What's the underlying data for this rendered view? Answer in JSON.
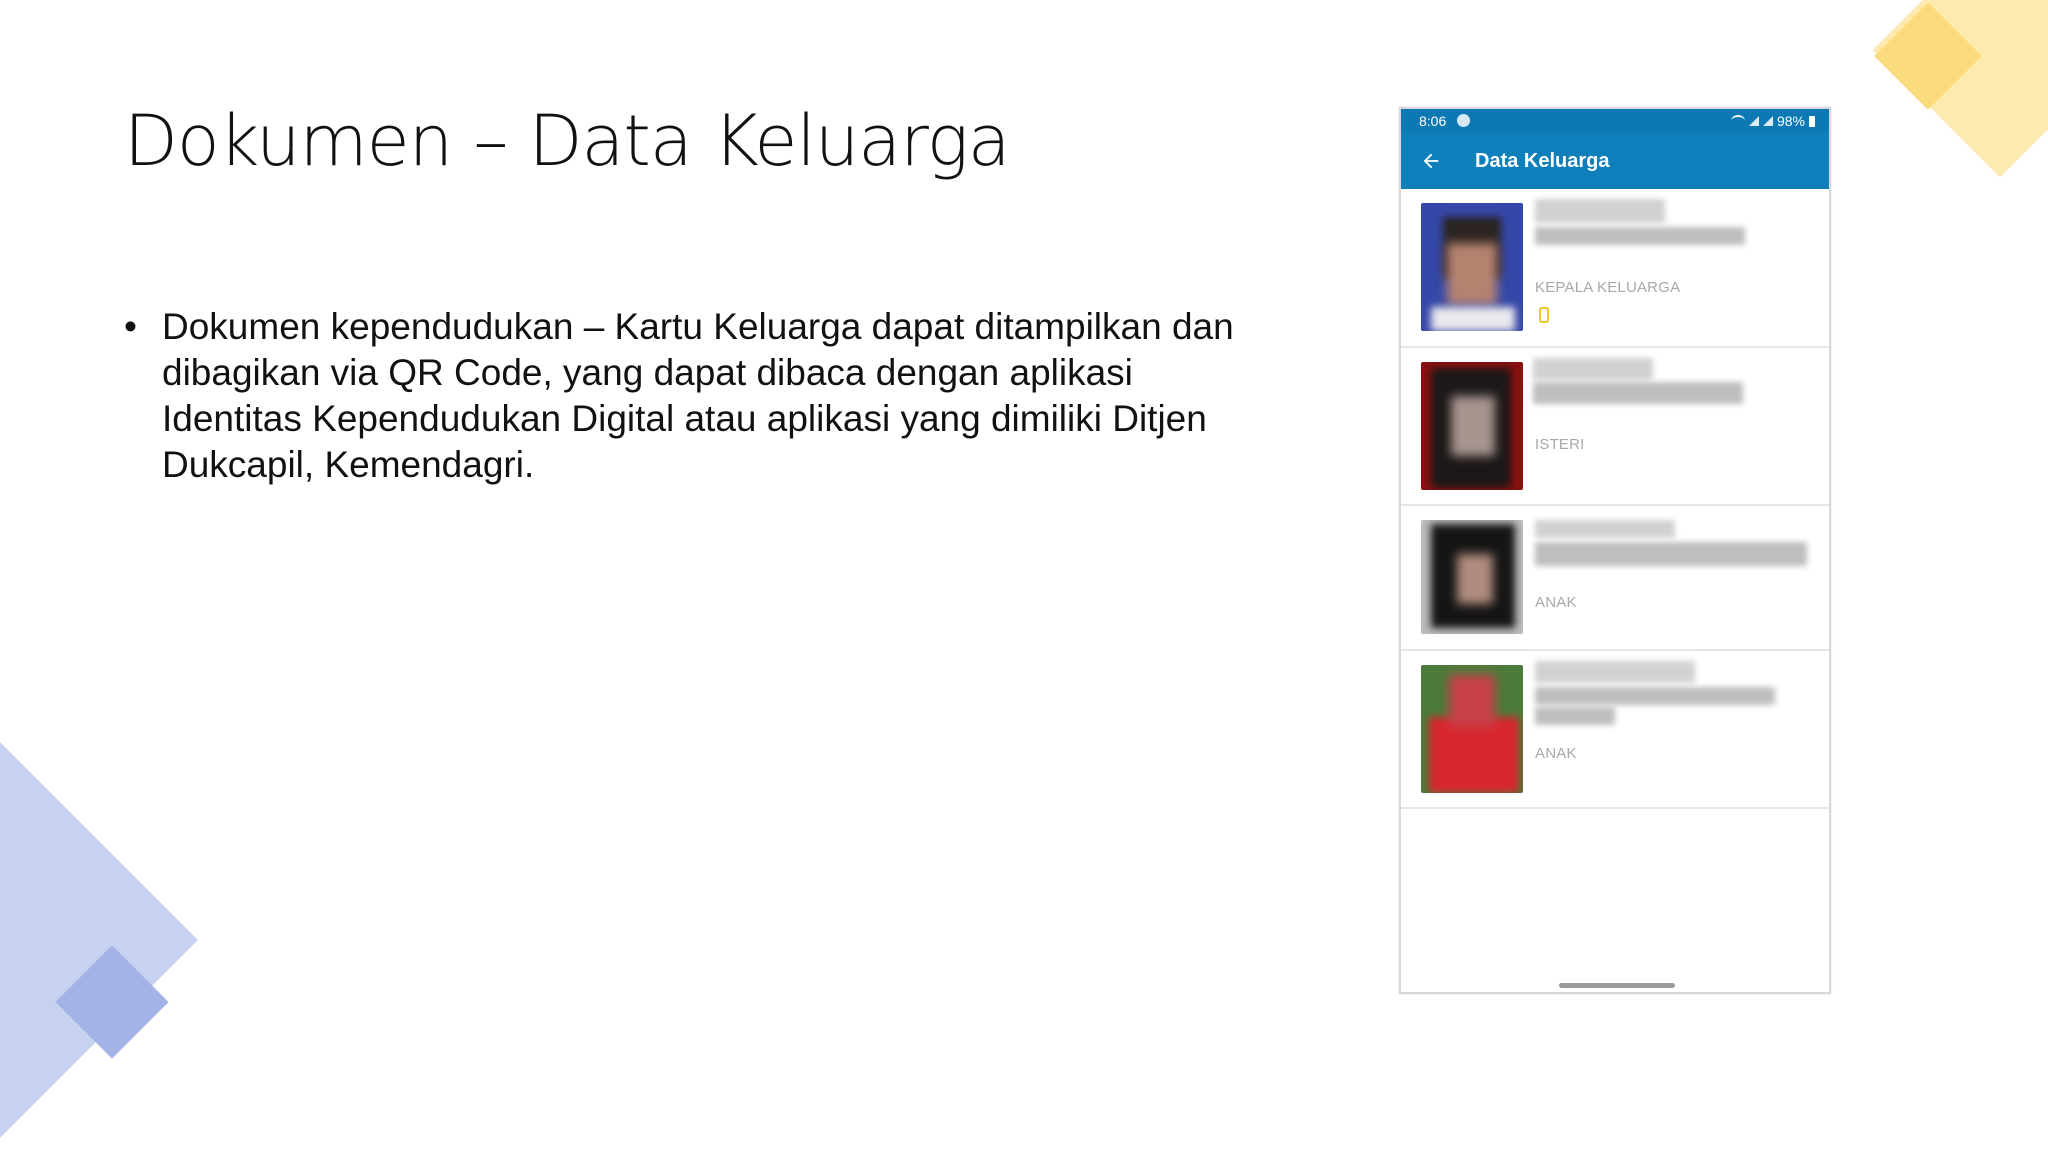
{
  "slide": {
    "title": "Dokumen – Data Keluarga",
    "bullets": [
      "Dokumen kependudukan – Kartu Keluarga dapat ditampilkan dan dibagikan via QR Code, yang dapat dibaca dengan aplikasi Identitas Kependudukan Digital atau aplikasi yang dimiliki Ditjen Dukcapil, Kemendagri."
    ]
  },
  "phone": {
    "status_bar": {
      "time": "8:06",
      "battery": "98%"
    },
    "app_bar": {
      "back_icon": "arrow-left-icon",
      "title": "Data Keluarga"
    },
    "members": [
      {
        "role": "KEPALA KELUARGA",
        "has_device_icon": true
      },
      {
        "role": "ISTERI"
      },
      {
        "role": "ANAK"
      },
      {
        "role": "ANAK"
      }
    ]
  },
  "colors": {
    "app_bar": "#0f7fbc",
    "status_bar": "#0c79b5",
    "device_icon": "#f2c230",
    "decor_yellow": "#fde7a6",
    "decor_blue": "#c2cdef"
  }
}
